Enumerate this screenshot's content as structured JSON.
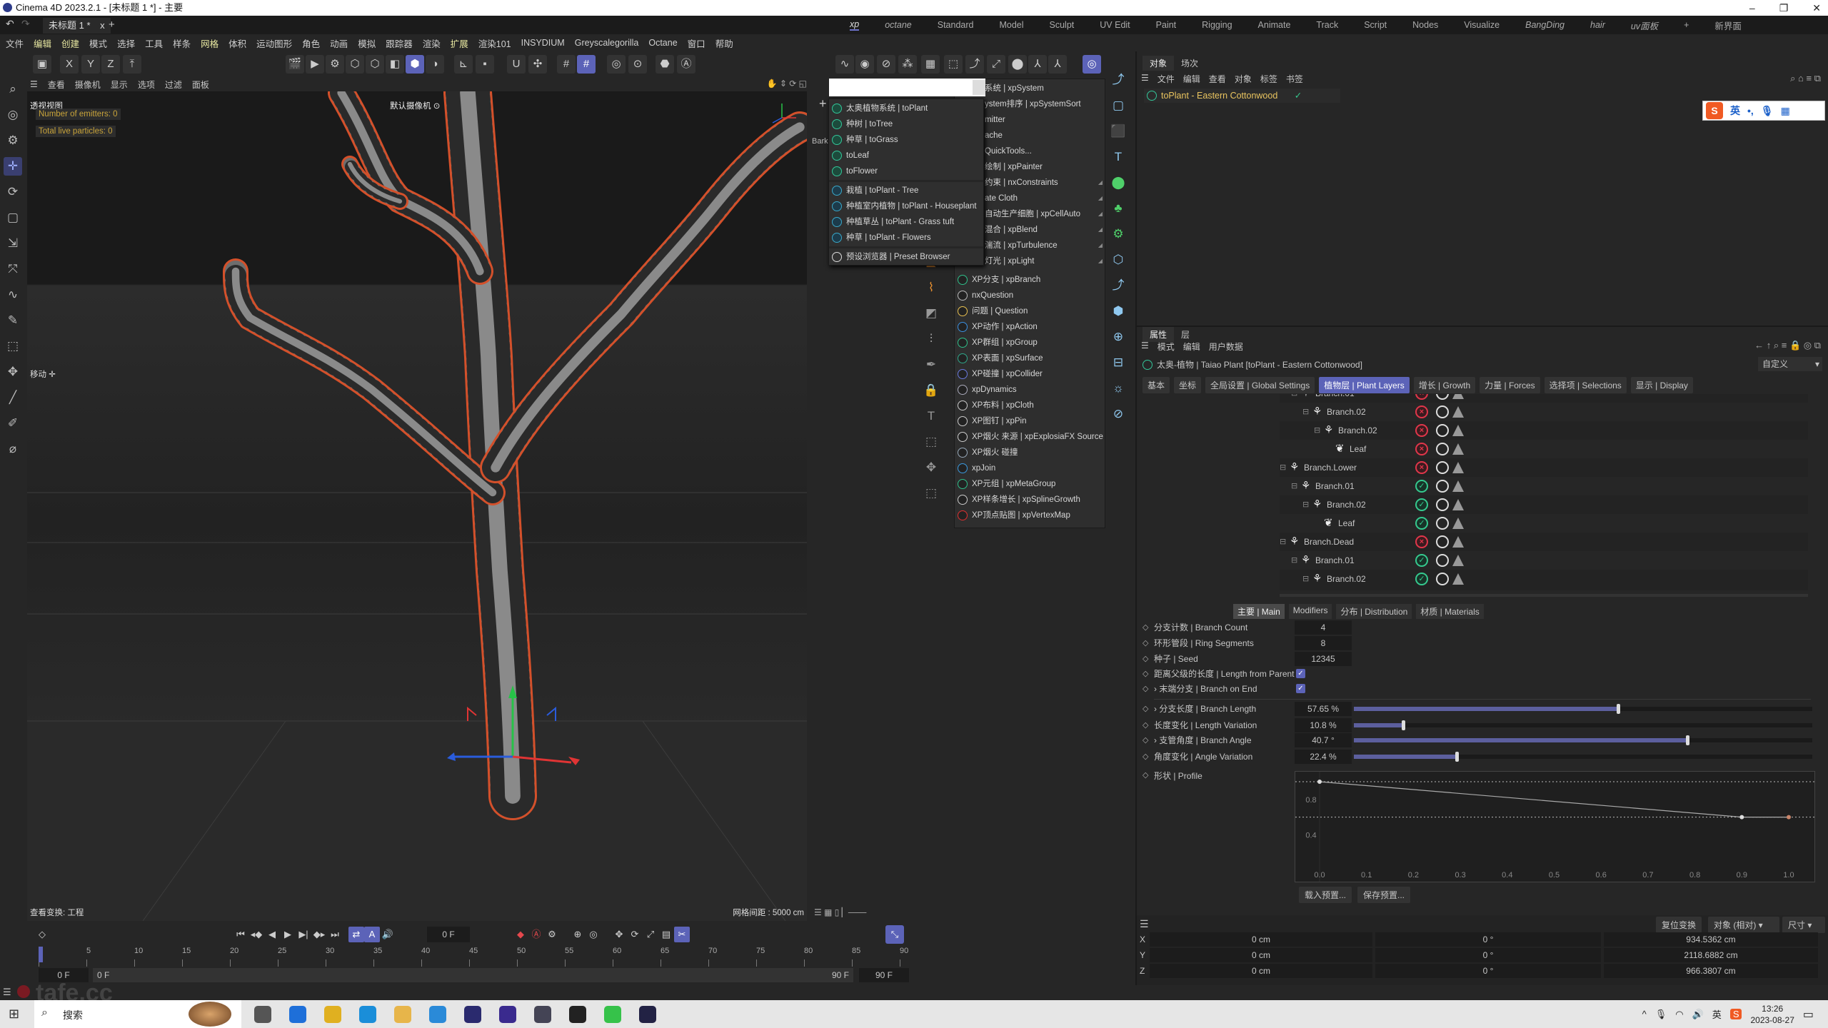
{
  "window": {
    "title": "Cinema 4D 2023.2.1 - [未标题 1 *] - 主要",
    "controls": [
      "–",
      "❐",
      "✕"
    ]
  },
  "doc_tab": {
    "label": "未标题 1 *",
    "close": "x",
    "add": "+"
  },
  "layouts": {
    "items": [
      {
        "label": "xp",
        "italic": true,
        "active": true
      },
      {
        "label": "octane",
        "italic": true
      },
      {
        "label": "Standard"
      },
      {
        "label": "Model"
      },
      {
        "label": "Sculpt"
      },
      {
        "label": "UV Edit"
      },
      {
        "label": "Paint"
      },
      {
        "label": "Rigging"
      },
      {
        "label": "Animate"
      },
      {
        "label": "Track"
      },
      {
        "label": "Script"
      },
      {
        "label": "Nodes"
      },
      {
        "label": "Visualize"
      },
      {
        "label": "BangDing",
        "italic": true
      },
      {
        "label": "hair",
        "italic": true
      },
      {
        "label": "uv面板",
        "italic": true
      },
      {
        "label": "+"
      },
      {
        "label": "新界面"
      }
    ]
  },
  "menubar": [
    "文件",
    "编辑",
    "创建",
    "模式",
    "选择",
    "工具",
    "样条",
    "网格",
    "体积",
    "运动图形",
    "角色",
    "动画",
    "模拟",
    "跟踪器",
    "渲染",
    "扩展",
    "渲染101",
    "INSYDIUM",
    "Greyscalegorilla",
    "Octane",
    "窗口",
    "帮助"
  ],
  "viewport": {
    "menu": [
      "查看",
      "摄像机",
      "显示",
      "选项",
      "过滤",
      "面板"
    ],
    "view_name": "透视视图",
    "camera": "默认摄像机 ⊙",
    "hud": [
      "Number of emitters: 0",
      "Total live particles: 0"
    ],
    "tool_label": "移动 ✛",
    "bottom_left": "查看变换: 工程",
    "grid_spacing": "网格间距 : 5000 cm",
    "side_label": "Bark"
  },
  "menu_left": {
    "groups": [
      [
        "太奥植物系统 | toPlant",
        "种树 | toTree",
        "种草 | toGrass",
        "toLeaf",
        "toFlower"
      ],
      [
        "栽植 | toPlant - Tree",
        "种植室内植物 | toPlant - Houseplant",
        "种植草丛 | toPlant - Grass tuft",
        "种草 | toPlant - Flowers"
      ],
      [
        "预设浏览器 | Preset Browser"
      ]
    ],
    "icon_color": "#33c79a"
  },
  "menu_right": {
    "upper": [
      "系统 | xpSystem",
      "ystem排序 | xpSystemSort",
      "mitter",
      "ache",
      "QuickTools...",
      "绘制 | xpPainter",
      "约束 | nxConstraints",
      "ate Cloth",
      "自动生产细胞 | xpCellAuto",
      "混合 | xpBlend",
      "湍流 | xpTurbulence",
      "灯光 | xpLight"
    ],
    "lower": [
      "XP分支 | xpBranch",
      "nxQuestion",
      "问题 | Question",
      "XP动作 | xpAction",
      "XP群组 | xpGroup",
      "XP表面 | xpSurface",
      "XP碰撞 | xpCollider",
      "xpDynamics",
      "XP布料 | xpCloth",
      "XP图钉 | xpPin",
      "XP烟火 来源 | xpExplosiaFX Source",
      "XP烟火 碰撞",
      "xpJoin",
      "XP元组 | xpMetaGroup",
      "XP样条增长 | xpSplineGrowth",
      "XP顶点贴图 | xpVertexMap"
    ]
  },
  "object_manager": {
    "tabs": [
      "对象",
      "场次"
    ],
    "menu": [
      "文件",
      "编辑",
      "查看",
      "对象",
      "标签",
      "书签"
    ],
    "object": "toPlant - Eastern Cottonwood",
    "ime": {
      "logo": "S",
      "lang": "英",
      "punct": "•,"
    }
  },
  "attributes": {
    "tabs": [
      "属性",
      "层"
    ],
    "menu": [
      "模式",
      "编辑",
      "用户数据"
    ],
    "object_title": "太奥-植物 | Taiao Plant [toPlant - Eastern Cottonwood]",
    "preset": "自定义",
    "main_tabs": [
      {
        "label": "基本"
      },
      {
        "label": "坐标"
      },
      {
        "label": "全局设置 | Global Settings"
      },
      {
        "label": "植物层 | Plant Layers",
        "active": true
      },
      {
        "label": "增长 | Growth"
      },
      {
        "label": "力量 | Forces"
      },
      {
        "label": "选择项 | Selections"
      },
      {
        "label": "显示 | Display"
      }
    ],
    "layers": [
      {
        "name": "Branch.01",
        "level": 1,
        "type": "branch",
        "enabled": false
      },
      {
        "name": "Branch.02",
        "level": 2,
        "type": "branch",
        "enabled": false
      },
      {
        "name": "Branch.02",
        "level": 3,
        "type": "branch",
        "enabled": false
      },
      {
        "name": "Leaf",
        "level": 4,
        "type": "leaf",
        "enabled": false
      },
      {
        "name": "Branch.Lower",
        "level": 0,
        "type": "branch",
        "enabled": false
      },
      {
        "name": "Branch.01",
        "level": 1,
        "type": "branch",
        "enabled": true
      },
      {
        "name": "Branch.02",
        "level": 2,
        "type": "branch",
        "enabled": true
      },
      {
        "name": "Leaf",
        "level": 3,
        "type": "leaf",
        "enabled": true
      },
      {
        "name": "Branch.Dead",
        "level": 0,
        "type": "branch",
        "enabled": false
      },
      {
        "name": "Branch.01",
        "level": 1,
        "type": "branch",
        "enabled": true
      },
      {
        "name": "Branch.02",
        "level": 2,
        "type": "branch",
        "enabled": true
      }
    ],
    "sub_tabs": [
      {
        "label": "主要 | Main",
        "active": true
      },
      {
        "label": "Modifiers"
      },
      {
        "label": "分布 | Distribution"
      },
      {
        "label": "材质 | Materials"
      }
    ],
    "params": [
      {
        "label": "分支计数 | Branch Count",
        "value": "4"
      },
      {
        "label": "环形管段 | Ring Segments",
        "value": "8"
      },
      {
        "label": "种子 | Seed",
        "value": "12345"
      },
      {
        "label": "距离父级的长度 | Length from Parent",
        "checked": true
      },
      {
        "label": "› 末端分支 | Branch on End",
        "checked": true
      }
    ],
    "sliders": [
      {
        "label": "› 分支长度 | Branch Length",
        "value": "57.65 %",
        "level": 0.5765
      },
      {
        "label": "长度变化 | Length Variation",
        "value": "10.8 %",
        "level": 0.108
      },
      {
        "label": "› 支管角度 | Branch Angle",
        "value": "40.7 °",
        "level": 0.727
      },
      {
        "label": "角度变化 | Angle Variation",
        "value": "22.4 %",
        "level": 0.224
      }
    ],
    "profile": {
      "label": "形状 | Profile",
      "x_ticks": [
        "0.0",
        "0.1",
        "0.2",
        "0.3",
        "0.4",
        "0.5",
        "0.6",
        "0.7",
        "0.8",
        "0.9",
        "1.0"
      ],
      "y_ticks": [
        "0.8",
        "0.4"
      ],
      "points": [
        [
          0.0,
          1.0
        ],
        [
          0.9,
          0.6
        ],
        [
          1.0,
          0.6
        ]
      ]
    },
    "buttons": [
      "载入预置...",
      "保存预置..."
    ]
  },
  "coordinates": {
    "reset": "复位变换",
    "mode": "对象 (相对)",
    "size_mode": "尺寸",
    "rows": [
      {
        "axis": "X",
        "pos": "0 cm",
        "rot": "0 °",
        "size": "934.5362 cm"
      },
      {
        "axis": "Y",
        "pos": "0 cm",
        "rot": "0 °",
        "size": "2118.6882 cm"
      },
      {
        "axis": "Z",
        "pos": "0 cm",
        "rot": "0 °",
        "size": "966.3807 cm"
      }
    ]
  },
  "timeline": {
    "current_frame": "0 F",
    "ticks": [
      "0",
      "5",
      "10",
      "15",
      "20",
      "25",
      "30",
      "35",
      "40",
      "45",
      "50",
      "55",
      "60",
      "65",
      "70",
      "75",
      "80",
      "85",
      "90"
    ],
    "start": "0 F",
    "range_start": "0 F",
    "range_end": "90 F",
    "end": "90 F"
  },
  "status": {
    "watermark": "tafe.cc"
  },
  "taskbar": {
    "search": "搜索",
    "time": "13:26",
    "date": "2023-08-27",
    "ime": "英"
  },
  "colors": {
    "accent": "#5c63b8",
    "selection_outline": "#d4502a",
    "object_text": "#e9c45f",
    "ok": "#35c98e",
    "off": "#e0364a"
  }
}
